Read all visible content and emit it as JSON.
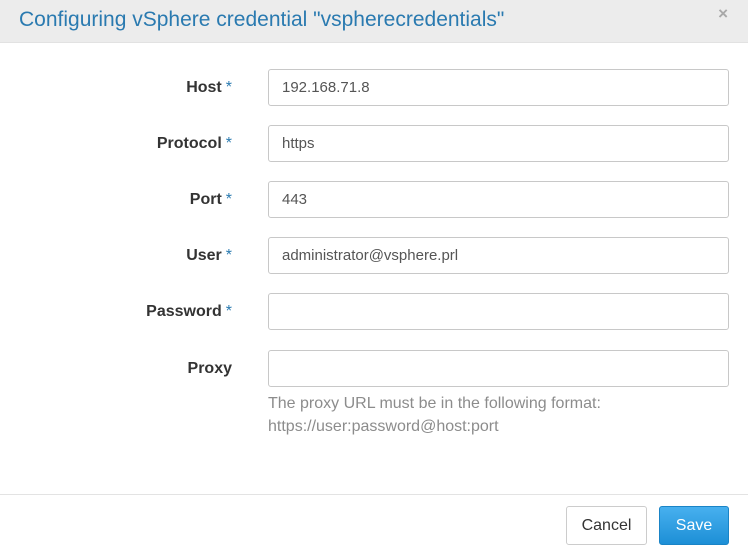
{
  "dialog": {
    "title": "Configuring vSphere credential \"vspherecredentials\"",
    "close_glyph": "×"
  },
  "form": {
    "required_marker": "*",
    "fields": [
      {
        "label": "Host",
        "value": "192.168.71.8",
        "required": true
      },
      {
        "label": "Protocol",
        "value": "https",
        "required": true
      },
      {
        "label": "Port",
        "value": "443",
        "required": true
      },
      {
        "label": "User",
        "value": "administrator@vsphere.prl",
        "required": true
      },
      {
        "label": "Password",
        "value": "",
        "required": true
      },
      {
        "label": "Proxy",
        "value": "",
        "required": false
      }
    ],
    "proxy_help_line1": "The proxy URL must be in the following format:",
    "proxy_help_line2": "https://user:password@host:port"
  },
  "footer": {
    "cancel_label": "Cancel",
    "save_label": "Save"
  },
  "colors": {
    "accent": "#2a7ab0",
    "save_button": "#2d9ee4",
    "header_bg": "#ececec"
  }
}
